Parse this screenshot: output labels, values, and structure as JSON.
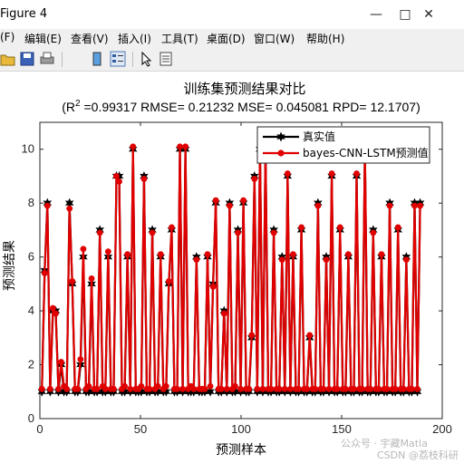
{
  "window": {
    "title": "Figure 4",
    "menu": [
      "(F)",
      "编辑(E)",
      "查看(V)",
      "插入(I)",
      "工具(T)",
      "桌面(D)",
      "窗口(W)",
      "帮助(H)"
    ],
    "toolbar_icons": [
      "open-icon",
      "save-icon",
      "print-icon",
      "colorbar-icon",
      "legend-icon",
      "arrow-icon",
      "propertyeditor-icon"
    ]
  },
  "watermark": {
    "line1": "公众号 · 宇藏Matla",
    "line2": "CSDN @荔枝科研"
  },
  "chart_data": {
    "type": "line",
    "title": "训练集预测结果对比",
    "subtitle_prefix": "(R",
    "subtitle_sup": "2",
    "subtitle_rest": " =0.99317 RMSE= 0.21232 MSE= 0.045081 RPD= 12.1707)",
    "xlabel": "预测样本",
    "ylabel": "预测结果",
    "xlim": [
      0,
      200
    ],
    "ylim": [
      0,
      11
    ],
    "xticks": [
      0,
      50,
      100,
      150,
      200
    ],
    "yticks": [
      0,
      2,
      4,
      6,
      8,
      10
    ],
    "grid": false,
    "legend_position": "top-right",
    "series": [
      {
        "name": "真实值",
        "color": "#000000",
        "marker": "hexagram",
        "values": [
          1,
          5.5,
          8,
          1,
          4,
          4,
          1,
          2,
          1,
          1,
          8,
          5,
          1,
          1,
          2,
          6,
          1,
          1,
          5,
          1,
          1,
          7,
          1,
          1,
          6,
          1,
          1,
          9,
          9,
          1,
          1,
          6,
          1,
          10,
          1,
          1,
          1,
          9,
          1,
          1,
          7,
          1,
          1,
          6,
          1,
          1,
          5,
          7,
          1,
          1,
          10,
          1,
          10,
          1,
          1,
          1,
          6,
          1,
          1,
          1,
          6,
          1,
          5,
          8,
          1,
          1,
          4,
          1,
          8,
          1,
          1,
          7,
          1,
          8,
          1,
          1,
          3,
          9,
          1,
          10,
          1,
          10,
          1,
          1,
          7,
          1,
          1,
          6,
          1,
          9,
          1,
          6,
          1,
          1,
          7,
          1,
          1,
          3,
          1,
          1,
          8,
          1,
          1,
          6,
          1,
          9,
          1,
          1,
          7,
          1,
          1,
          6,
          1,
          1,
          9,
          1,
          1,
          10,
          1,
          1,
          7,
          1,
          1,
          6,
          1,
          1,
          8,
          1,
          1,
          7,
          1,
          1,
          6,
          1,
          1,
          8,
          1,
          8
        ]
      },
      {
        "name": "bayes-CNN-LSTM预测值",
        "color": "#e00000",
        "marker": "circle",
        "values": [
          1.1,
          5.4,
          7.9,
          1.1,
          4.1,
          3.9,
          1.1,
          2.1,
          1.2,
          1.1,
          7.8,
          5.1,
          1.1,
          1.1,
          2.2,
          6.3,
          1.1,
          1.2,
          5.2,
          1.1,
          1.1,
          6.9,
          1.2,
          1.1,
          6.2,
          1.1,
          1.1,
          9.0,
          8.8,
          1.1,
          1.2,
          6.1,
          1.1,
          10.1,
          1.1,
          1.1,
          1.2,
          8.9,
          1.1,
          1.1,
          6.9,
          1.1,
          1.2,
          6.1,
          1.1,
          1.2,
          5.1,
          7.1,
          1.1,
          1.1,
          10.1,
          1.1,
          10.1,
          1.1,
          1.2,
          1.1,
          5.9,
          1.1,
          1.1,
          1.1,
          6.1,
          1.2,
          4.9,
          8.1,
          1.1,
          1.1,
          3.9,
          1.1,
          7.9,
          1.1,
          1.2,
          6.9,
          1.1,
          8.1,
          1.1,
          1.1,
          3.1,
          8.9,
          1.1,
          10.1,
          1.1,
          10.1,
          1.1,
          1.1,
          6.9,
          1.1,
          1.1,
          5.9,
          1.1,
          9.1,
          1.1,
          6.1,
          1.1,
          1.1,
          7.1,
          1.1,
          1.1,
          3.1,
          1.1,
          1.1,
          7.9,
          1.1,
          1.1,
          5.9,
          1.1,
          9.1,
          1.1,
          1.1,
          7.1,
          1.1,
          1.1,
          6.1,
          1.1,
          1.1,
          9.1,
          1.1,
          1.1,
          10.1,
          1.1,
          1.1,
          6.9,
          1.1,
          1.1,
          6.1,
          1.1,
          1.1,
          7.9,
          1.1,
          1.1,
          7.1,
          1.1,
          1.1,
          5.9,
          1.1,
          1.1,
          7.9,
          1.1,
          7.9
        ]
      }
    ]
  }
}
